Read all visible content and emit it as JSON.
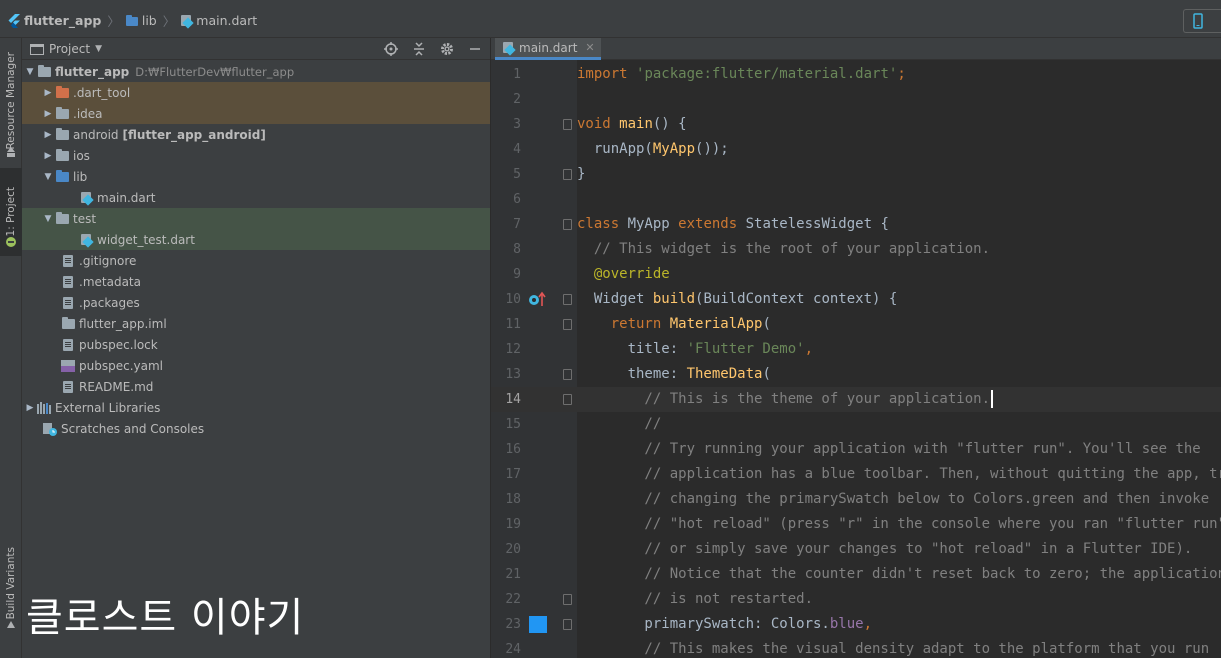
{
  "breadcrumb": {
    "project": "flutter_app",
    "folder": "lib",
    "file": "main.dart"
  },
  "left_strip": {
    "resource_manager": "Resource Manager",
    "project_tab": "1: Project",
    "build_variants": "Build Variants"
  },
  "project_panel": {
    "title": "Project",
    "tree": {
      "root": {
        "name": "flutter_app",
        "path": "D:₩FlutterDev₩flutter_app"
      },
      "dart_tool": ".dart_tool",
      "idea": ".idea",
      "android_name": "android",
      "android_module": "[flutter_app_android]",
      "ios": "ios",
      "lib": "lib",
      "main_dart": "main.dart",
      "test": "test",
      "widget_test": "widget_test.dart",
      "gitignore": ".gitignore",
      "metadata": ".metadata",
      "packages": ".packages",
      "iml": "flutter_app.iml",
      "pubspec_lock": "pubspec.lock",
      "pubspec_yaml": "pubspec.yaml",
      "readme": "README.md",
      "external_libraries": "External Libraries",
      "scratches": "Scratches and Consoles"
    }
  },
  "watermark": "클로스트 이야기",
  "editor": {
    "tab_label": "main.dart",
    "lines": [
      {
        "n": "1",
        "parts": [
          {
            "c": "kw",
            "t": "import "
          },
          {
            "c": "str",
            "t": "'package:flutter/material.dart'"
          },
          {
            "c": "kw",
            "t": ";"
          }
        ]
      },
      {
        "n": "2",
        "parts": []
      },
      {
        "n": "3",
        "parts": [
          {
            "c": "kw",
            "t": "void "
          },
          {
            "c": "fn",
            "t": "main"
          },
          {
            "c": "",
            "t": "() {"
          }
        ]
      },
      {
        "n": "4",
        "parts": [
          {
            "c": "",
            "t": "  runApp("
          },
          {
            "c": "fn",
            "t": "MyApp"
          },
          {
            "c": "",
            "t": "());"
          }
        ]
      },
      {
        "n": "5",
        "parts": [
          {
            "c": "",
            "t": "}"
          }
        ]
      },
      {
        "n": "6",
        "parts": []
      },
      {
        "n": "7",
        "parts": [
          {
            "c": "kw",
            "t": "class "
          },
          {
            "c": "",
            "t": "MyApp "
          },
          {
            "c": "kw",
            "t": "extends "
          },
          {
            "c": "",
            "t": "StatelessWidget {"
          }
        ]
      },
      {
        "n": "8",
        "parts": [
          {
            "c": "cm",
            "t": "  // This widget is the root of your application."
          }
        ]
      },
      {
        "n": "9",
        "parts": [
          {
            "c": "ann",
            "t": "  @override"
          }
        ]
      },
      {
        "n": "10",
        "parts": [
          {
            "c": "",
            "t": "  Widget "
          },
          {
            "c": "fn",
            "t": "build"
          },
          {
            "c": "",
            "t": "(BuildContext context) {"
          }
        ]
      },
      {
        "n": "11",
        "parts": [
          {
            "c": "kw",
            "t": "    return "
          },
          {
            "c": "fn",
            "t": "MaterialApp"
          },
          {
            "c": "",
            "t": "("
          }
        ]
      },
      {
        "n": "12",
        "parts": [
          {
            "c": "",
            "t": "      title: "
          },
          {
            "c": "str",
            "t": "'Flutter Demo'"
          },
          {
            "c": "kw",
            "t": ","
          }
        ]
      },
      {
        "n": "13",
        "parts": [
          {
            "c": "",
            "t": "      theme: "
          },
          {
            "c": "fn",
            "t": "ThemeData"
          },
          {
            "c": "",
            "t": "("
          }
        ]
      },
      {
        "n": "14",
        "parts": [
          {
            "c": "cm",
            "t": "        // This is the theme of your application."
          }
        ]
      },
      {
        "n": "15",
        "parts": [
          {
            "c": "cm",
            "t": "        //"
          }
        ]
      },
      {
        "n": "16",
        "parts": [
          {
            "c": "cm",
            "t": "        // Try running your application with \"flutter run\". You'll see the"
          }
        ]
      },
      {
        "n": "17",
        "parts": [
          {
            "c": "cm",
            "t": "        // application has a blue toolbar. Then, without quitting the app, try"
          }
        ]
      },
      {
        "n": "18",
        "parts": [
          {
            "c": "cm",
            "t": "        // changing the primarySwatch below to Colors.green and then invoke"
          }
        ]
      },
      {
        "n": "19",
        "parts": [
          {
            "c": "cm",
            "t": "        // \"hot reload\" (press \"r\" in the console where you ran \"flutter run\","
          }
        ]
      },
      {
        "n": "20",
        "parts": [
          {
            "c": "cm",
            "t": "        // or simply save your changes to \"hot reload\" in a Flutter IDE)."
          }
        ]
      },
      {
        "n": "21",
        "parts": [
          {
            "c": "cm",
            "t": "        // Notice that the counter didn't reset back to zero; the application"
          }
        ]
      },
      {
        "n": "22",
        "parts": [
          {
            "c": "cm",
            "t": "        // is not restarted."
          }
        ]
      },
      {
        "n": "23",
        "parts": [
          {
            "c": "",
            "t": "        primarySwatch: Colors."
          },
          {
            "c": "fld",
            "t": "blue"
          },
          {
            "c": "kw",
            "t": ","
          }
        ]
      },
      {
        "n": "24",
        "parts": [
          {
            "c": "cm",
            "t": "        // This makes the visual density adapt to the platform that you run"
          }
        ]
      }
    ]
  },
  "colors": {
    "keyword": "#cc7832",
    "string": "#6a8759",
    "function": "#ffc66d",
    "comment": "#808080",
    "annotation": "#bbb529",
    "field": "#9876aa",
    "swatch": "#2196f3"
  }
}
